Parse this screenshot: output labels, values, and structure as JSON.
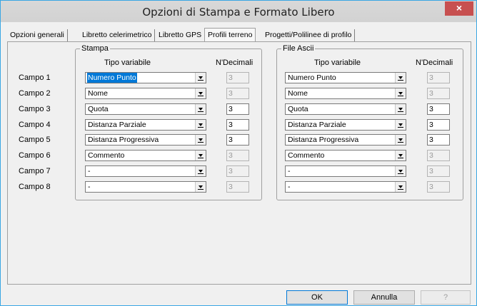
{
  "window": {
    "title": "Opzioni di Stampa e Formato Libero",
    "close_label": "×"
  },
  "tabs": [
    {
      "label": "Opzioni generali",
      "active": false
    },
    {
      "label": "Libretto celerimetrico",
      "active": false
    },
    {
      "label": "Libretto GPS",
      "active": false
    },
    {
      "label": "Profili terreno",
      "active": true
    },
    {
      "label": "Progetti/Polilinee di profilo",
      "active": false
    }
  ],
  "stampa": {
    "legend": "Stampa",
    "col_tipo": "Tipo variabile",
    "col_dec": "N'Decimali",
    "rows": [
      {
        "label": "Campo 1",
        "value": "Numero Punto",
        "decimals": "3",
        "dec_enabled": false
      },
      {
        "label": "Campo 2",
        "value": "Nome",
        "decimals": "3",
        "dec_enabled": false
      },
      {
        "label": "Campo 3",
        "value": "Quota",
        "decimals": "3",
        "dec_enabled": true
      },
      {
        "label": "Campo 4",
        "value": "Distanza Parziale",
        "decimals": "3",
        "dec_enabled": true
      },
      {
        "label": "Campo 5",
        "value": "Distanza Progressiva",
        "decimals": "3",
        "dec_enabled": true
      },
      {
        "label": "Campo 6",
        "value": "Commento",
        "decimals": "3",
        "dec_enabled": false
      },
      {
        "label": "Campo 7",
        "value": "-",
        "decimals": "3",
        "dec_enabled": false
      },
      {
        "label": "Campo 8",
        "value": "-",
        "decimals": "3",
        "dec_enabled": false
      }
    ]
  },
  "ascii": {
    "legend": "File Ascii",
    "col_tipo": "Tipo variabile",
    "col_dec": "N'Decimali",
    "rows": [
      {
        "value": "Numero Punto",
        "decimals": "3",
        "dec_enabled": false
      },
      {
        "value": "Nome",
        "decimals": "3",
        "dec_enabled": false
      },
      {
        "value": "Quota",
        "decimals": "3",
        "dec_enabled": true
      },
      {
        "value": "Distanza Parziale",
        "decimals": "3",
        "dec_enabled": true
      },
      {
        "value": "Distanza Progressiva",
        "decimals": "3",
        "dec_enabled": true
      },
      {
        "value": "Commento",
        "decimals": "3",
        "dec_enabled": false
      },
      {
        "value": "-",
        "decimals": "3",
        "dec_enabled": false
      },
      {
        "value": "-",
        "decimals": "3",
        "dec_enabled": false
      }
    ]
  },
  "buttons": {
    "ok": "OK",
    "cancel": "Annulla",
    "help": "?"
  }
}
